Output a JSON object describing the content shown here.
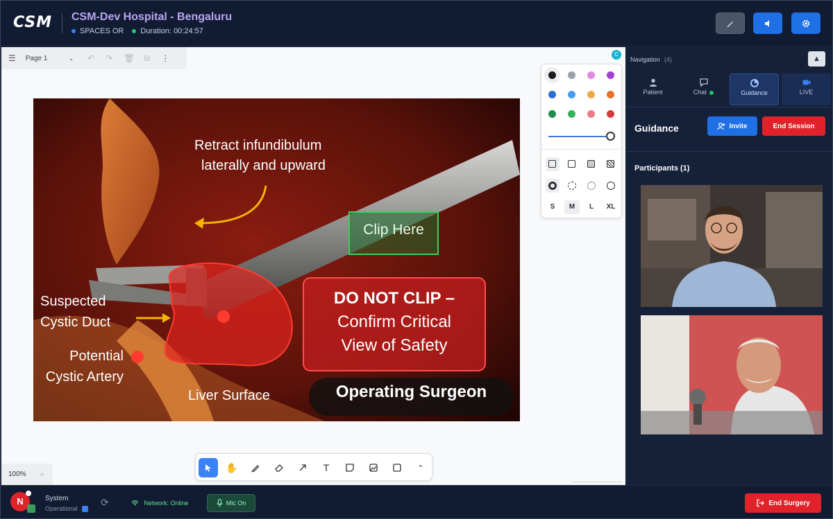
{
  "header": {
    "logo": "CSM",
    "title": "CSM-Dev Hospital - Bengaluru",
    "room": "SPACES OR",
    "duration": "Duration: 00:24:57"
  },
  "canvas": {
    "page_label": "Page 1",
    "zoom": "100%",
    "collaborator_initial": "C",
    "annotations": {
      "retract": [
        "Retract infundibulum",
        "laterally and upward"
      ],
      "clip_here": "Clip Here",
      "do_not_clip": [
        "DO NOT CLIP –",
        "Confirm Critical",
        "View of Safety"
      ],
      "suspected": [
        "Suspected",
        "Cystic Duct"
      ],
      "potential": [
        "Potential",
        "Cystic Artery"
      ],
      "liver": "Liver Surface",
      "surgeon": "Operating Surgeon"
    },
    "palette": {
      "colors": [
        "#1b1b1b",
        "#9aa1ac",
        "#e08ae6",
        "#a43fd1",
        "#2b6fd6",
        "#4a9cf0",
        "#f0a94a",
        "#e5732b",
        "#1e8c4a",
        "#35b35a",
        "#ec7b86",
        "#d83a3a"
      ],
      "sizes": [
        "S",
        "M",
        "L",
        "XL"
      ],
      "selected_size": "M"
    }
  },
  "right_panel": {
    "navigation_label": "Navigation",
    "navigation_count": "(4)",
    "tabs": [
      {
        "label": "Patient"
      },
      {
        "label": "Chat"
      },
      {
        "label": "Guidance"
      },
      {
        "label": "LIVE"
      }
    ],
    "active_tab": "Guidance",
    "guidance_title": "Guidance",
    "invite_label": "Invite",
    "end_session_label": "End Session",
    "participants_label": "Participants (1)"
  },
  "bottom_bar": {
    "avatar_initial": "N",
    "system_label": "System",
    "status_label": "Operational",
    "network_label": "Network: Online",
    "mic_label": "Mic On",
    "end_surgery_label": "End Surgery"
  },
  "colors": {
    "background": "#101b31",
    "accent_blue": "#1f6fe5",
    "danger_red": "#e0232a",
    "title_purple": "#b9a7f0",
    "online_green": "#5ee38a"
  },
  "icons": [
    "menu-icon",
    "chevron-down-icon",
    "undo-icon",
    "redo-icon",
    "trash-icon",
    "copy-icon",
    "more-icon",
    "pen-icon",
    "speaker-icon",
    "gear-icon",
    "user-icon",
    "chat-icon",
    "guidance-icon",
    "video-icon",
    "add-user-icon",
    "refresh-icon",
    "wifi-icon",
    "mic-icon",
    "exit-icon",
    "cursor-icon",
    "hand-icon",
    "pencil-icon",
    "eraser-icon",
    "arrow-icon",
    "text-icon",
    "sticky-note-icon",
    "image-icon",
    "rectangle-icon",
    "chevron-up-icon"
  ]
}
